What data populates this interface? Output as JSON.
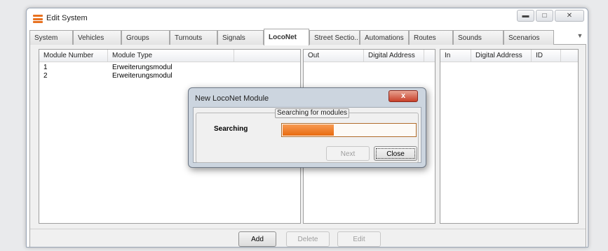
{
  "window": {
    "title": "Edit System",
    "controls": [
      "minimize-icon",
      "maximize-icon",
      "close-icon"
    ]
  },
  "tabs": [
    {
      "label": "System"
    },
    {
      "label": "Vehicles"
    },
    {
      "label": "Groups"
    },
    {
      "label": "Turnouts"
    },
    {
      "label": "Signals"
    },
    {
      "label": "LocoNet",
      "active": true
    },
    {
      "label": "Street Sectio.."
    },
    {
      "label": "Automations"
    },
    {
      "label": "Routes"
    },
    {
      "label": "Sounds"
    },
    {
      "label": "Scenarios"
    }
  ],
  "modules_list": {
    "columns": [
      "Module Number",
      "Module Type"
    ],
    "rows": [
      {
        "number": "1",
        "type": "Erweiterungsmodul"
      },
      {
        "number": "2",
        "type": "Erweiterungsmodul"
      }
    ]
  },
  "out_list": {
    "columns": [
      "Out",
      "Digital Address"
    ],
    "rows": []
  },
  "in_list": {
    "columns": [
      "In",
      "Digital Address",
      "ID"
    ],
    "rows": []
  },
  "buttons": {
    "add": "Add",
    "delete": "Delete",
    "edit": "Edit"
  },
  "dialog": {
    "title": "New LocoNet Module",
    "close_glyph": "x",
    "group_title": "Searching for modules",
    "status_label": "Searching",
    "progress_fraction": 0.38,
    "next_label": "Next",
    "close_label": "Close"
  },
  "colors": {
    "accent_orange": "#e8711f",
    "dialog_close_red": "#c8402a"
  }
}
